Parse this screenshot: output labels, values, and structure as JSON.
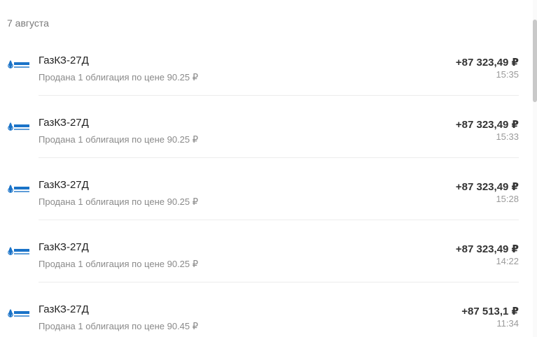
{
  "date_header": "7 августа",
  "operations": [
    {
      "logo": "gazprom-logo",
      "title": "ГазКЗ-27Д",
      "subtitle": "Продана 1 облигация по цене 90.25 ₽",
      "amount": "+87 323,49 ₽",
      "time": "15:35"
    },
    {
      "logo": "gazprom-logo",
      "title": "ГазКЗ-27Д",
      "subtitle": "Продана 1 облигация по цене 90.25 ₽",
      "amount": "+87 323,49 ₽",
      "time": "15:33"
    },
    {
      "logo": "gazprom-logo",
      "title": "ГазКЗ-27Д",
      "subtitle": "Продана 1 облигация по цене 90.25 ₽",
      "amount": "+87 323,49 ₽",
      "time": "15:28"
    },
    {
      "logo": "gazprom-logo",
      "title": "ГазКЗ-27Д",
      "subtitle": "Продана 1 облигация по цене 90.25 ₽",
      "amount": "+87 323,49 ₽",
      "time": "14:22"
    },
    {
      "logo": "gazprom-logo",
      "title": "ГазКЗ-27Д",
      "subtitle": "Продана 1 облигация по цене 90.45 ₽",
      "amount": "+87 513,1 ₽",
      "time": "11:34"
    }
  ],
  "colors": {
    "brand_blue": "#1a73c8",
    "text_primary": "#222222",
    "text_secondary": "#8a8a8a"
  }
}
